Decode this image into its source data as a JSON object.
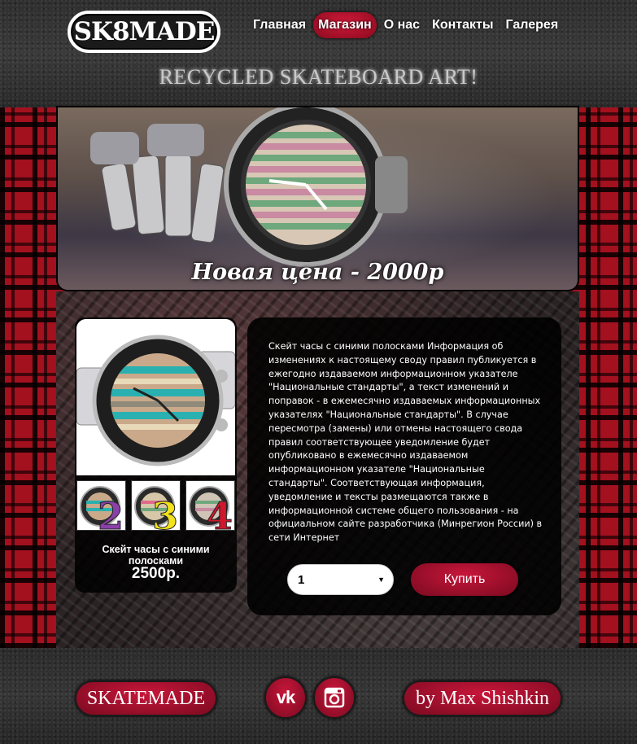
{
  "header": {
    "logo_text": "SK8MADE",
    "tagline": "RECYCLED SKATEBOARD ART!",
    "nav": [
      {
        "label": "Главная",
        "active": false
      },
      {
        "label": "Магазин",
        "active": true
      },
      {
        "label": "О нас",
        "active": false
      },
      {
        "label": "Контакты",
        "active": false
      },
      {
        "label": "Галерея",
        "active": false
      }
    ]
  },
  "hero": {
    "caption": "Новая цена   -  2000р"
  },
  "product": {
    "name": "Скейт часы с синими полосками",
    "price": "2500р.",
    "thumbnails": [
      {
        "number": "2",
        "color": "#8b3fa8"
      },
      {
        "number": "3",
        "color": "#f2e21a"
      },
      {
        "number": "4",
        "color": "#d0182c"
      }
    ],
    "description": "Скейт часы с синими полосками Информация об изменениях к настоящему своду правил публикуется в ежегодно издаваемом информационном указателе \"Национальные стандарты\", а текст изменений и поправок - в ежемесячно издаваемых информационных указателях \"Национальные стандарты\". В случае пересмотра (замены) или отмены настоящего свода правил соответствующее уведомление будет опубликовано в ежемесячно издаваемом информационном указателе \"Национальные стандарты\". Соответствующая информация, уведомление и тексты размещаются также в информационной системе общего пользования - на официальном сайте разработчика (Минрегион России) в сети Интернет",
    "quantity": "1",
    "buy_label": "Купить"
  },
  "footer": {
    "left_label": "SKATEMADE",
    "right_label": "by Max Shishkin",
    "social": [
      {
        "icon": "vk-icon",
        "label": "vk"
      },
      {
        "icon": "instagram-icon"
      }
    ]
  },
  "colors": {
    "accent": "#b0102e",
    "plaid_red": "#a3101e"
  }
}
